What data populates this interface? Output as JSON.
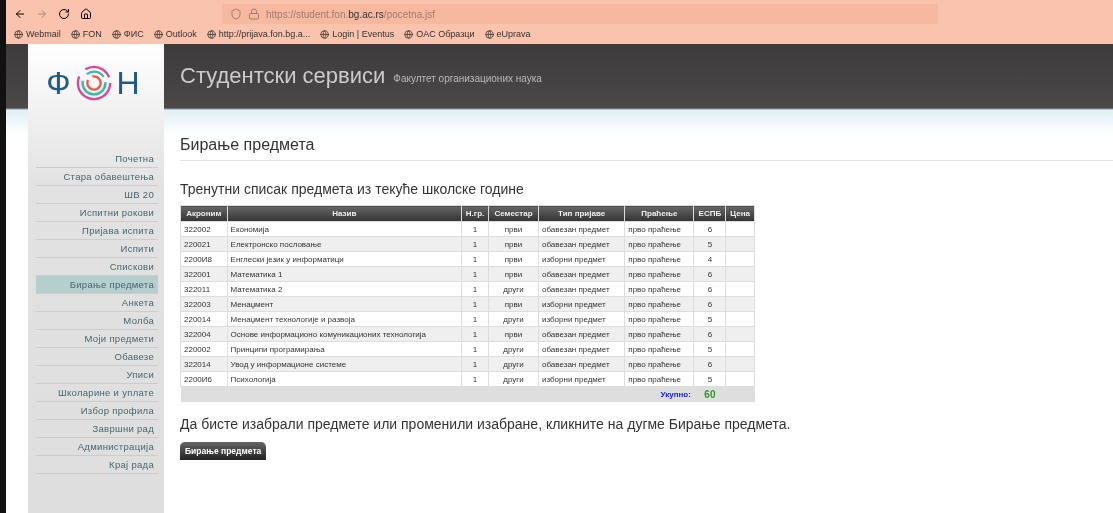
{
  "browser": {
    "url_prefix": "https://student.fon.",
    "url_domain": "bg.ac.rs",
    "url_path": "/pocetna.jsf",
    "bookmarks": [
      "Webmail",
      "FON",
      "ФИС",
      "Outlook",
      "http://prijava.fon.bg.a...",
      "Login | Eventus",
      "OAC Образци",
      "eUprava"
    ]
  },
  "header": {
    "logo_left": "Ф",
    "logo_right": "Н",
    "title": "Студентски сервиси",
    "subtitle": "Факултет организационих наука"
  },
  "sidebar": {
    "items": [
      {
        "label": "Почетна",
        "selected": false
      },
      {
        "label": "Стара обавештења",
        "selected": false
      },
      {
        "label": "ШВ 20",
        "selected": false
      },
      {
        "label": "Испитни рокови",
        "selected": false
      },
      {
        "label": "Пријава испита",
        "selected": false
      },
      {
        "label": "Испити",
        "selected": false
      },
      {
        "label": "Спискови",
        "selected": false
      },
      {
        "label": "Бирање предмета",
        "selected": true
      },
      {
        "label": "Анкета",
        "selected": false
      },
      {
        "label": "Молба",
        "selected": false
      },
      {
        "label": "Моји предмети",
        "selected": false
      },
      {
        "label": "Обавезе",
        "selected": false
      },
      {
        "label": "Уписи",
        "selected": false
      },
      {
        "label": "Школарине и уплате",
        "selected": false
      },
      {
        "label": "Избор профила",
        "selected": false
      },
      {
        "label": "Завршни рад",
        "selected": false
      },
      {
        "label": "Администрација",
        "selected": false
      },
      {
        "label": "Крај рада",
        "selected": false
      }
    ]
  },
  "page_title": "Бирање предмета",
  "section_title": "Тренутни списак предмета из текуће школске године",
  "table": {
    "columns": [
      "Акроним",
      "Назив",
      "Н.гр.",
      "Семестар",
      "Тип пријаве",
      "Праћење",
      "ЕСПБ",
      "Цена"
    ],
    "rows": [
      [
        "322002",
        "Економија",
        "1",
        "први",
        "обавезан предмет",
        "прво праћење",
        "6"
      ],
      [
        "220021",
        "Електронско пословање",
        "1",
        "први",
        "обавезан предмет",
        "прво праћење",
        "5"
      ],
      [
        "2200И8",
        "Енглески језик у информатици",
        "1",
        "први",
        "изборни предмет",
        "прво праћење",
        "4"
      ],
      [
        "322001",
        "Математика 1",
        "1",
        "први",
        "обавезан предмет",
        "прво праћење",
        "6"
      ],
      [
        "322011",
        "Математика 2",
        "1",
        "други",
        "обавезан предмет",
        "прво праћење",
        "6"
      ],
      [
        "322003",
        "Менаџмент",
        "1",
        "први",
        "изборни предмет",
        "прво праћење",
        "6"
      ],
      [
        "220014",
        "Менаџмент технологије и развоја",
        "1",
        "други",
        "изборни предмет",
        "прво праћење",
        "5"
      ],
      [
        "322004",
        "Основе информационо комуникационих технологија",
        "1",
        "први",
        "обавезан предмет",
        "прво праћење",
        "6"
      ],
      [
        "220002",
        "Принципи програмирања",
        "1",
        "други",
        "обавезан предмет",
        "прво праћење",
        "5"
      ],
      [
        "322014",
        "Увод у информационе системе",
        "1",
        "други",
        "обавезан предмет",
        "прво праћење",
        "6"
      ],
      [
        "2200И6",
        "Психологија",
        "1",
        "други",
        "изборни предмет",
        "прво праћење",
        "5"
      ]
    ],
    "total_label": "Укупно:",
    "total_value": "60"
  },
  "instruction": "Да бисте изабрали предмете или променили изабране, кликните на дугме Бирање предмета.",
  "action_button": "Бирање предмета"
}
